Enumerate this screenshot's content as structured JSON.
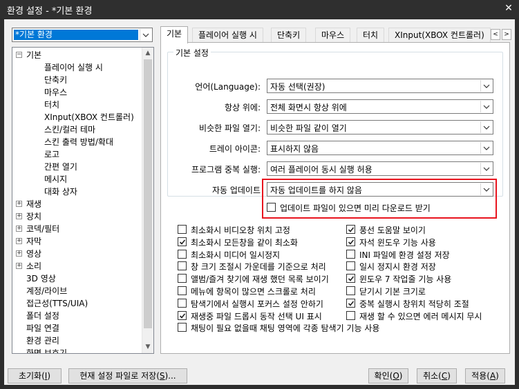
{
  "window": {
    "title": "환경 설정 - *기본 환경",
    "close_glyph": "✕"
  },
  "preset": {
    "value": "*기본 환경"
  },
  "tree": {
    "items": [
      {
        "label": "기본",
        "level": 0,
        "expander": "−",
        "selected": false
      },
      {
        "label": "플레이어 실행 시",
        "level": 1
      },
      {
        "label": "단축키",
        "level": 1
      },
      {
        "label": "마우스",
        "level": 1
      },
      {
        "label": "터치",
        "level": 1
      },
      {
        "label": "XInput(XBOX 컨트롤러)",
        "level": 1
      },
      {
        "label": "스킨/컬러 테마",
        "level": 1
      },
      {
        "label": "스킨 출력 방법/확대",
        "level": 1
      },
      {
        "label": "로고",
        "level": 1
      },
      {
        "label": "간편 열기",
        "level": 1
      },
      {
        "label": "메시지",
        "level": 1
      },
      {
        "label": "대화 상자",
        "level": 1
      },
      {
        "label": "재생",
        "level": 0,
        "expander": "+"
      },
      {
        "label": "장치",
        "level": 0,
        "expander": "+"
      },
      {
        "label": "코덱/필터",
        "level": 0,
        "expander": "+"
      },
      {
        "label": "자막",
        "level": 0,
        "expander": "+"
      },
      {
        "label": "영상",
        "level": 0,
        "expander": "+"
      },
      {
        "label": "소리",
        "level": 0,
        "expander": "+"
      },
      {
        "label": "3D 영상",
        "level": 0
      },
      {
        "label": "계정/라이브",
        "level": 0
      },
      {
        "label": "접근성(TTS/UIA)",
        "level": 0
      },
      {
        "label": "폴더 설정",
        "level": 0
      },
      {
        "label": "파일 연결",
        "level": 0
      },
      {
        "label": "환경 관리",
        "level": 0
      },
      {
        "label": "화면 보호기",
        "level": 0
      }
    ]
  },
  "tabs": {
    "items": [
      "기본",
      "플레이어 실행 시",
      "단축키",
      "마우스",
      "터치",
      "XInput(XBOX 컨트롤러)"
    ],
    "active_index": 0,
    "prev": "<",
    "next": ">"
  },
  "basic": {
    "group_title": "기본 설정",
    "settings": [
      {
        "label": "언어(Language):",
        "value": "자동 선택(권장)"
      },
      {
        "label": "항상 위에:",
        "value": "전체 화면시 항상 위에"
      },
      {
        "label": "비슷한 파일 열기:",
        "value": "비슷한 파일 같이 열기"
      },
      {
        "label": "트레이 아이콘:",
        "value": "표시하지 않음"
      },
      {
        "label": "프로그램 중복 실행:",
        "value": "여러 플레이어 동시 실행 허용"
      },
      {
        "label": "자동 업데이트",
        "value": "자동 업데이트를 하지 않음"
      }
    ],
    "predownload": {
      "label": "업데이트 파일이 있으면 미리 다운로드 받기",
      "checked": false
    }
  },
  "options": {
    "left": [
      {
        "label": "최소화시 비디오창 위치 고정",
        "checked": false
      },
      {
        "label": "최소화시 모든창을 같이 최소화",
        "checked": true
      },
      {
        "label": "최소화시 미디어 일시정지",
        "checked": false
      },
      {
        "label": "창 크기 조절시 가운데를 기준으로 처리",
        "checked": false
      },
      {
        "label": "앨범/즐겨 찾기에 재생 했던 목록 보이기",
        "checked": false
      },
      {
        "label": "메뉴에 항목이 많으면 스크롤로 처리",
        "checked": false
      },
      {
        "label": "탐색기에서 실행시 포커스 설정 안하기",
        "checked": false
      },
      {
        "label": "재생중 파일 드롭시 동작 선택 UI 표시",
        "checked": true
      },
      {
        "label": "채팅이 필요 없을때 채팅 영역에 각종 탐색기 기능 사용",
        "checked": false
      }
    ],
    "right": [
      {
        "label": "풍선 도움말 보이기",
        "checked": true
      },
      {
        "label": "자석 윈도우 기능 사용",
        "checked": true
      },
      {
        "label": "INI 파일에 환경 설정 저장",
        "checked": false
      },
      {
        "label": "일시 정지시 환경 저장",
        "checked": false
      },
      {
        "label": "윈도우 7 작업줄 기능 사용",
        "checked": true
      },
      {
        "label": "닫기시 기본 크기로",
        "checked": false
      },
      {
        "label": "중복 실행시 창위치 적당히 조절",
        "checked": true
      },
      {
        "label": "재생 할 수 있으면 에러 메시지 무시",
        "checked": false
      }
    ]
  },
  "buttons": {
    "reset": {
      "text": "초기화",
      "key": "I",
      "pre": "(",
      "post": ")"
    },
    "save_as": {
      "text": "현재 설정 파일로 저장",
      "key": "S",
      "pre": "(",
      "post": ")..."
    },
    "ok": {
      "text": "확인",
      "key": "O",
      "pre": "(",
      "post": ")"
    },
    "cancel": {
      "text": "취소",
      "key": "C",
      "pre": "(",
      "post": ")"
    },
    "apply": {
      "text": "적용",
      "key": "A",
      "pre": "(",
      "post": ")"
    }
  },
  "colors": {
    "accent": "#0078d7",
    "highlight_border": "#e8141e",
    "titlebar": "#2f2f2f"
  }
}
